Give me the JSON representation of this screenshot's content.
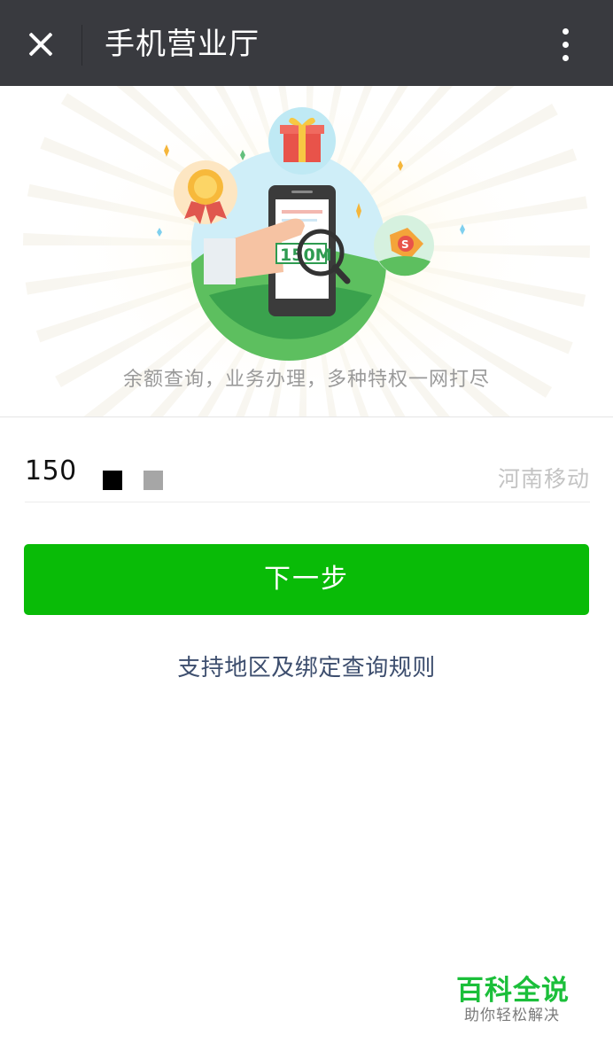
{
  "header": {
    "title": "手机营业厅",
    "close_icon": "close-icon",
    "menu_icon": "more-vertical-icon",
    "background": "#393a3f"
  },
  "banner": {
    "tagline": "余额查询，业务办理，多种特权一网打尽",
    "phone_screen_text": "150M",
    "icons": [
      "medal-icon",
      "gift-icon",
      "price-tag-icon",
      "magnifier-icon",
      "phone-icon"
    ]
  },
  "form": {
    "phone_number": "150",
    "carrier": "河南移动",
    "next_label": "下一步",
    "rules_link": "支持地区及绑定查询规则",
    "accent": "#09bb07",
    "link_color": "#3d4e6e"
  },
  "watermark": {
    "title": "百科全说",
    "subtitle": "助你轻松解决"
  }
}
